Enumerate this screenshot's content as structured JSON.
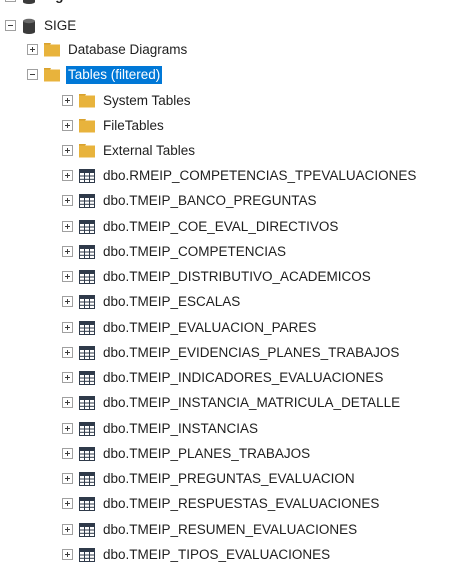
{
  "colors": {
    "selection": "#0078d7",
    "folder": "#e8b33c",
    "table_icon": "#2f3a4a"
  },
  "server_node": {
    "label": "sige"
  },
  "database": {
    "label": "SIGE",
    "icon": "database-cylinder-icon"
  },
  "database_children": [
    {
      "label": "Database Diagrams",
      "icon": "folder-icon"
    },
    {
      "label": "Tables (filtered)",
      "icon": "folder-icon",
      "expanded": true,
      "selected": true
    }
  ],
  "table_folders": [
    {
      "label": "System Tables",
      "icon": "folder-icon"
    },
    {
      "label": "FileTables",
      "icon": "folder-icon"
    },
    {
      "label": "External Tables",
      "icon": "folder-icon"
    }
  ],
  "tables": [
    "dbo.RMEIP_COMPETENCIAS_TPEVALUACIONES",
    "dbo.TMEIP_BANCO_PREGUNTAS",
    "dbo.TMEIP_COE_EVAL_DIRECTIVOS",
    "dbo.TMEIP_COMPETENCIAS",
    "dbo.TMEIP_DISTRIBUTIVO_ACADEMICOS",
    "dbo.TMEIP_ESCALAS",
    "dbo.TMEIP_EVALUACION_PARES",
    "dbo.TMEIP_EVIDENCIAS_PLANES_TRABAJOS",
    "dbo.TMEIP_INDICADORES_EVALUACIONES",
    "dbo.TMEIP_INSTANCIA_MATRICULA_DETALLE",
    "dbo.TMEIP_INSTANCIAS",
    "dbo.TMEIP_PLANES_TRABAJOS",
    "dbo.TMEIP_PREGUNTAS_EVALUACION",
    "dbo.TMEIP_RESPUESTAS_EVALUACIONES",
    "dbo.TMEIP_RESUMEN_EVALUACIONES",
    "dbo.TMEIP_TIPOS_EVALUACIONES"
  ]
}
